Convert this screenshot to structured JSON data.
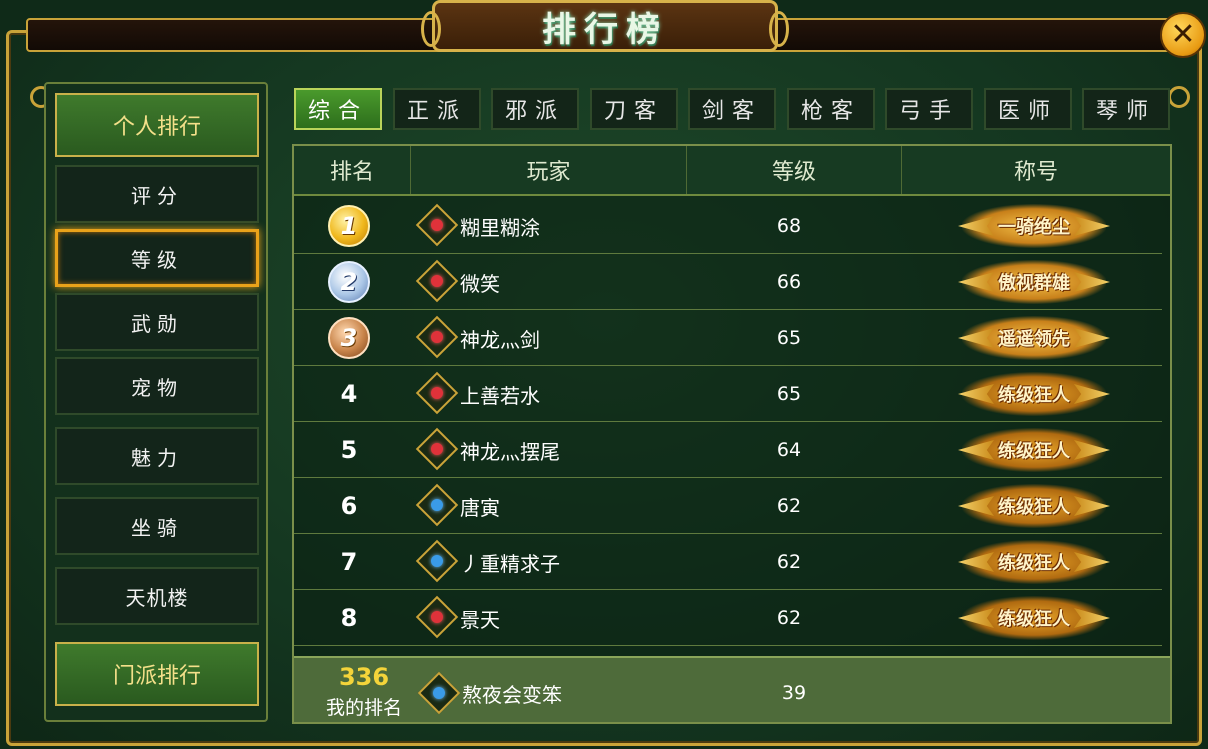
{
  "window": {
    "title": "排行榜",
    "close_label": "✕"
  },
  "sidebar": {
    "category_personal": "个人排行",
    "items": [
      {
        "label": "评分",
        "active": false
      },
      {
        "label": "等级",
        "active": true
      },
      {
        "label": "武勋",
        "active": false
      },
      {
        "label": "宠物",
        "active": false
      },
      {
        "label": "魅力",
        "active": false
      },
      {
        "label": "坐骑",
        "active": false
      },
      {
        "label": "天机楼",
        "active": false
      }
    ],
    "category_sect": "门派排行"
  },
  "tabs": [
    {
      "label": "综合",
      "active": true
    },
    {
      "label": "正派",
      "active": false
    },
    {
      "label": "邪派",
      "active": false
    },
    {
      "label": "刀客",
      "active": false
    },
    {
      "label": "剑客",
      "active": false
    },
    {
      "label": "枪客",
      "active": false
    },
    {
      "label": "弓手",
      "active": false
    },
    {
      "label": "医师",
      "active": false
    },
    {
      "label": "琴师",
      "active": false
    }
  ],
  "table": {
    "headers": {
      "rank": "排名",
      "player": "玩家",
      "level": "等级",
      "title": "称号"
    },
    "rows": [
      {
        "rank": "1",
        "medal": "medal-1",
        "icon": "red-class-icon",
        "name": "糊里糊涂",
        "level": "68",
        "title": "一骑绝尘"
      },
      {
        "rank": "2",
        "medal": "medal-2",
        "icon": "red-class-icon",
        "name": "微笑",
        "level": "66",
        "title": "傲视群雄"
      },
      {
        "rank": "3",
        "medal": "medal-3",
        "icon": "red-class-icon",
        "name": "神龙灬剑",
        "level": "65",
        "title": "遥遥领先"
      },
      {
        "rank": "4",
        "medal": "",
        "icon": "red-class-icon",
        "name": "上善若水",
        "level": "65",
        "title": "练级狂人"
      },
      {
        "rank": "5",
        "medal": "",
        "icon": "red-class-icon",
        "name": "神龙灬摆尾",
        "level": "64",
        "title": "练级狂人"
      },
      {
        "rank": "6",
        "medal": "",
        "icon": "blue-class-icon",
        "name": "唐寅",
        "level": "62",
        "title": "练级狂人"
      },
      {
        "rank": "7",
        "medal": "",
        "icon": "blue-class-icon",
        "name": "丿重精求子",
        "level": "62",
        "title": "练级狂人"
      },
      {
        "rank": "8",
        "medal": "",
        "icon": "red-class-icon",
        "name": "景天",
        "level": "62",
        "title": "练级狂人"
      }
    ]
  },
  "my_rank": {
    "rank": "336",
    "label": "我的排名",
    "icon": "blue-class-icon",
    "name": "熬夜会变笨",
    "level": "39"
  }
}
